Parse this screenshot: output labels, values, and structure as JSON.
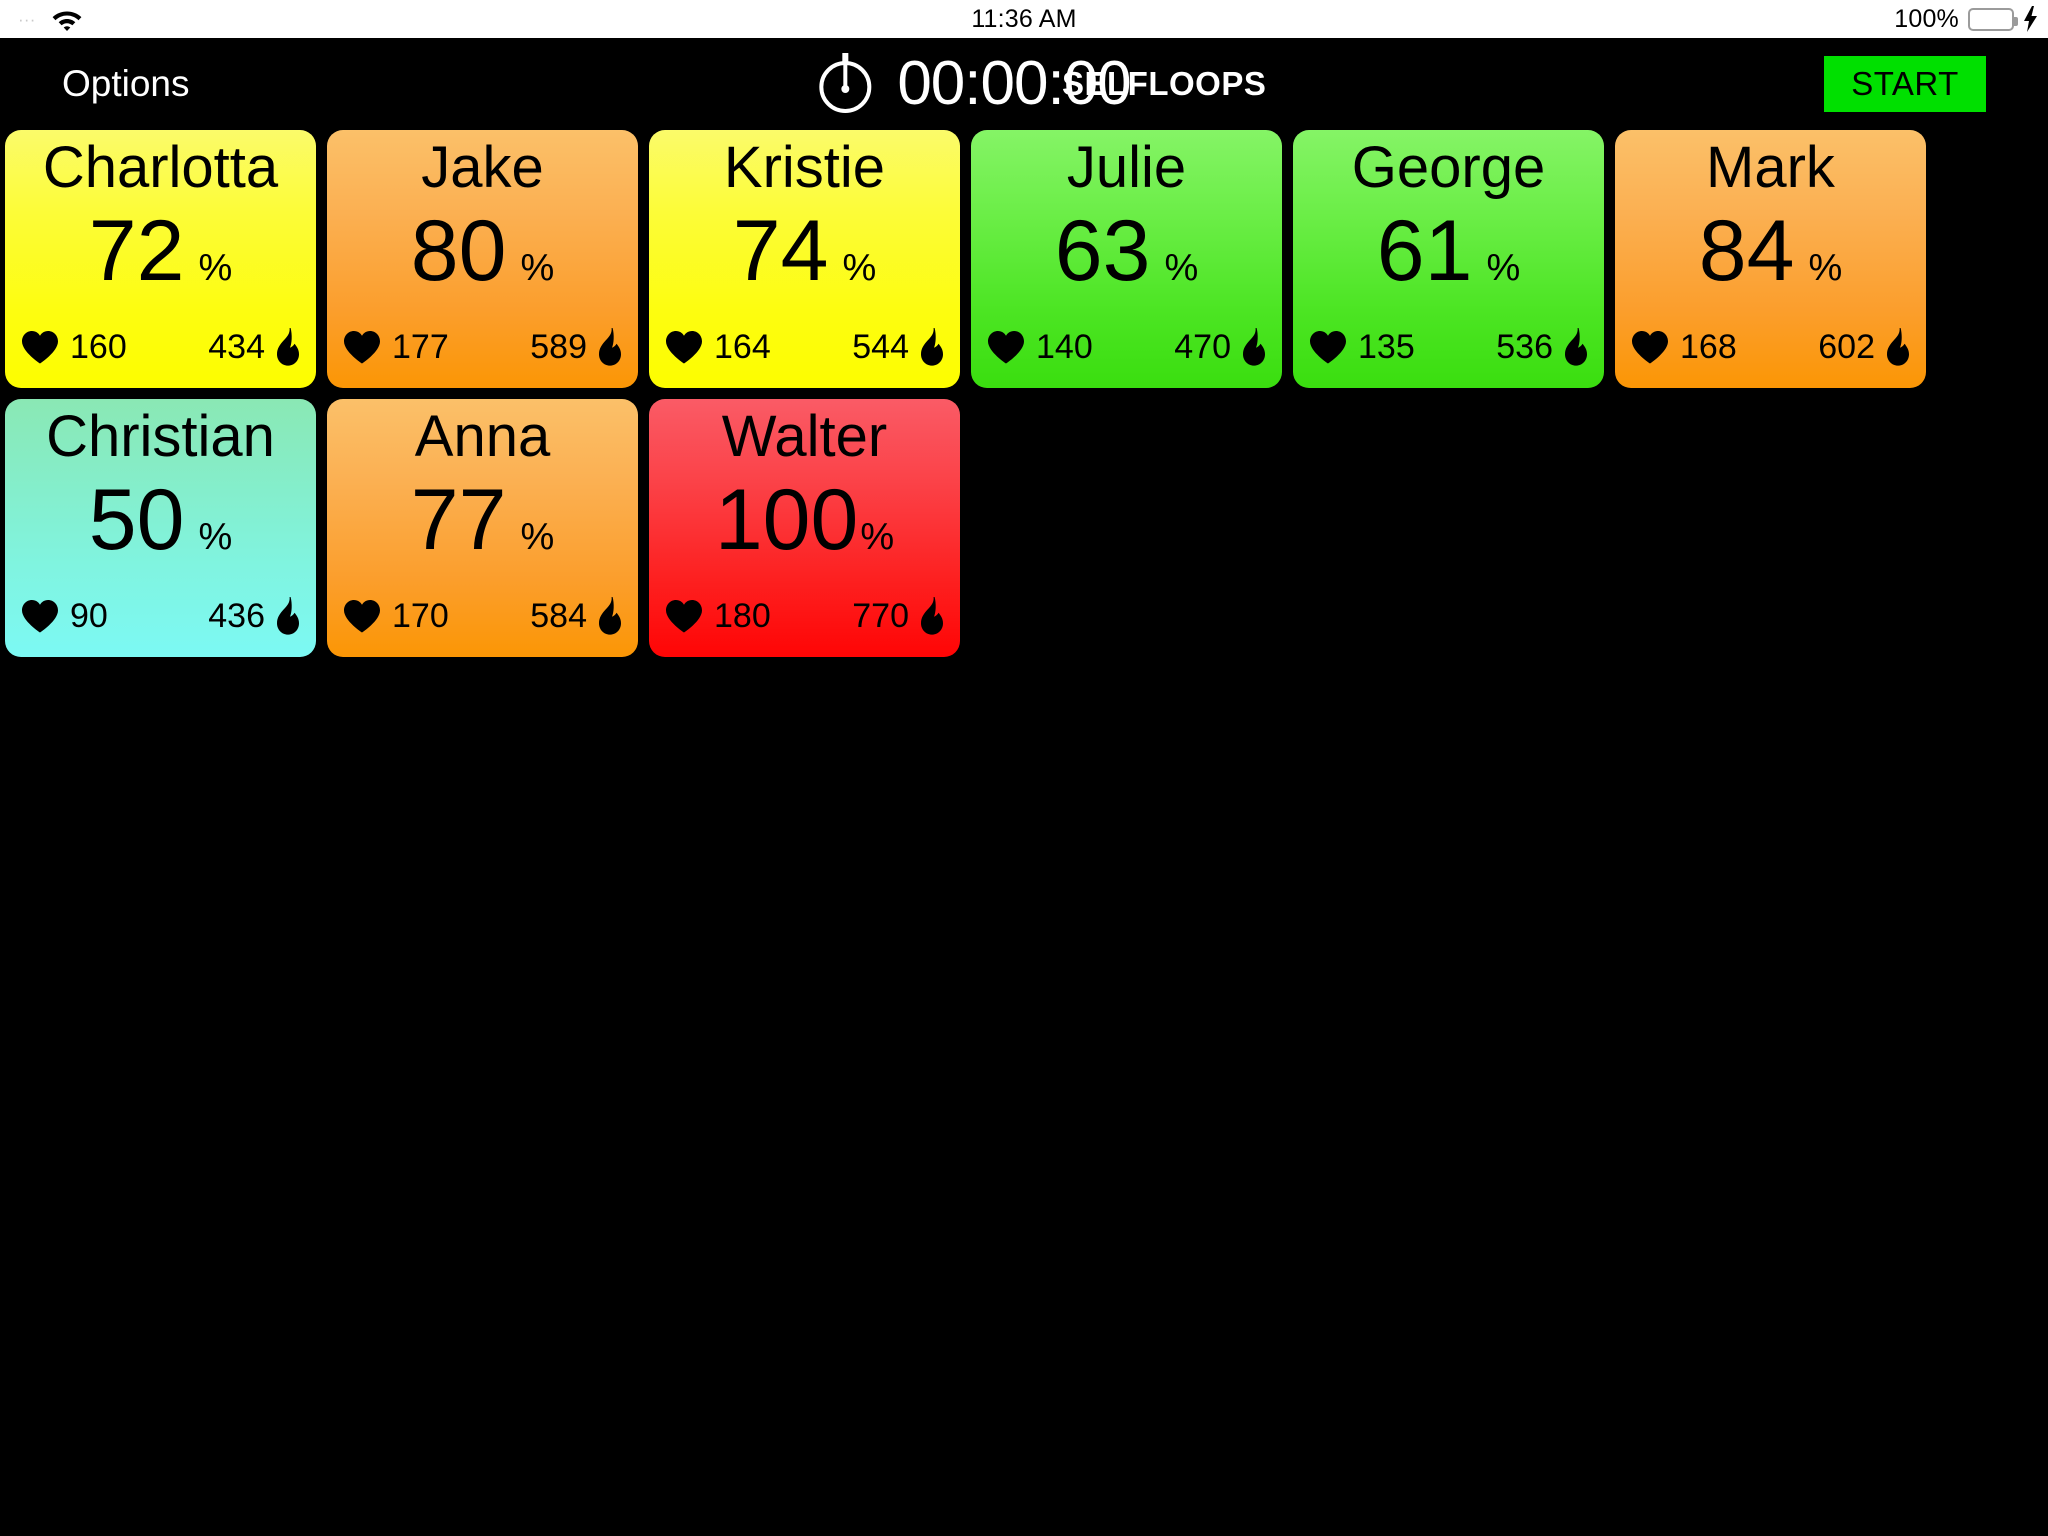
{
  "statusbar": {
    "time": "11:36 AM",
    "battery_percent": "100%",
    "wifi_icon": "wifi-icon",
    "battery_icon": "battery-icon",
    "charging_icon": "lightning-bolt-icon",
    "battery_fill_color": "#4cd964"
  },
  "navbar": {
    "options_label": "Options",
    "timer_icon": "stopwatch-icon",
    "timer_value": "00:00:00",
    "app_title": "SELFLOOPS",
    "start_label": "START",
    "start_color": "#00e000"
  },
  "legend": {
    "heart_icon": "heart-icon",
    "flame_icon": "flame-icon",
    "percent_sign": "%"
  },
  "athletes": [
    {
      "name": "Charlotta",
      "percent": "72",
      "percent_sign": "%",
      "hr": "160",
      "calories": "434",
      "zone": "yellow",
      "zone_color": "#fdfd00"
    },
    {
      "name": "Jake",
      "percent": "80",
      "percent_sign": "%",
      "hr": "177",
      "calories": "589",
      "zone": "orange",
      "zone_color": "#fb9605"
    },
    {
      "name": "Kristie",
      "percent": "74",
      "percent_sign": "%",
      "hr": "164",
      "calories": "544",
      "zone": "yellow",
      "zone_color": "#fdfd00"
    },
    {
      "name": "Julie",
      "percent": "63",
      "percent_sign": "%",
      "hr": "140",
      "calories": "470",
      "zone": "green",
      "zone_color": "#3ade0f"
    },
    {
      "name": "George",
      "percent": "61",
      "percent_sign": "%",
      "hr": "135",
      "calories": "536",
      "zone": "green",
      "zone_color": "#3ade0f"
    },
    {
      "name": "Mark",
      "percent": "84",
      "percent_sign": "%",
      "hr": "168",
      "calories": "602",
      "zone": "orange",
      "zone_color": "#fb9605"
    },
    {
      "name": "Christian",
      "percent": "50",
      "percent_sign": "%",
      "hr": "90",
      "calories": "436",
      "zone": "cyan",
      "zone_color": "#7cf9f4"
    },
    {
      "name": "Anna",
      "percent": "77",
      "percent_sign": "%",
      "hr": "170",
      "calories": "584",
      "zone": "orange",
      "zone_color": "#fb9605"
    },
    {
      "name": "Walter",
      "percent": "100",
      "percent_sign": "%",
      "hr": "180",
      "calories": "770",
      "zone": "red",
      "zone_color": "#ff0505"
    }
  ]
}
